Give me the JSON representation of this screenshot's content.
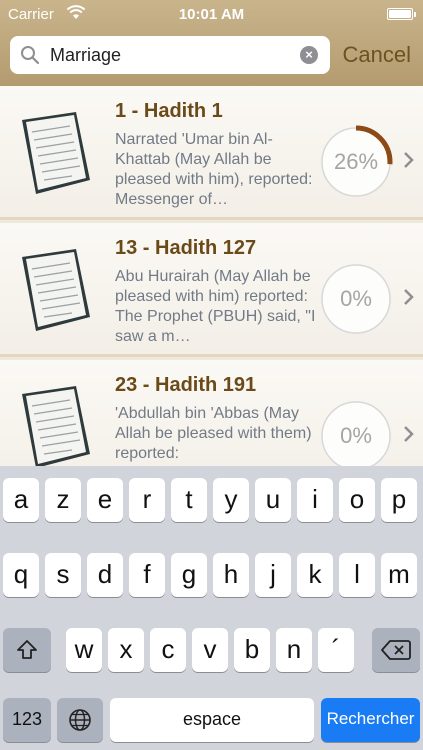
{
  "status": {
    "carrier": "Carrier",
    "time": "10:01 AM"
  },
  "search": {
    "value": "Marriage",
    "cancel_label": "Cancel"
  },
  "results": [
    {
      "title": "1 - Hadith 1",
      "excerpt": "Narrated 'Umar bin Al-Khattab (May Allah be pleased with him), reported: Messenger of…",
      "progress_label": "26%",
      "progress": 0.26
    },
    {
      "title": "13 - Hadith 127",
      "excerpt": "Abu Hurairah (May Allah be pleased with him) reported: The Prophet (PBUH) said, \"I saw a m…",
      "progress_label": "0%",
      "progress": 0
    },
    {
      "title": "23 - Hadith 191",
      "excerpt": "'Abdullah bin 'Abbas (May Allah be pleased with them) reported:",
      "progress_label": "0%",
      "progress": 0
    }
  ],
  "keyboard": {
    "row1": [
      "a",
      "z",
      "e",
      "r",
      "t",
      "y",
      "u",
      "i",
      "o",
      "p"
    ],
    "row2": [
      "q",
      "s",
      "d",
      "f",
      "g",
      "h",
      "j",
      "k",
      "l",
      "m"
    ],
    "row3": [
      "w",
      "x",
      "c",
      "v",
      "b",
      "n",
      "´"
    ],
    "numbers_label": "123",
    "space_label": "espace",
    "return_label": "Rechercher"
  },
  "colors": {
    "accent": "#6b4a1a",
    "progress": "#8b4a16",
    "keyboard_action": "#1a7cf5"
  }
}
